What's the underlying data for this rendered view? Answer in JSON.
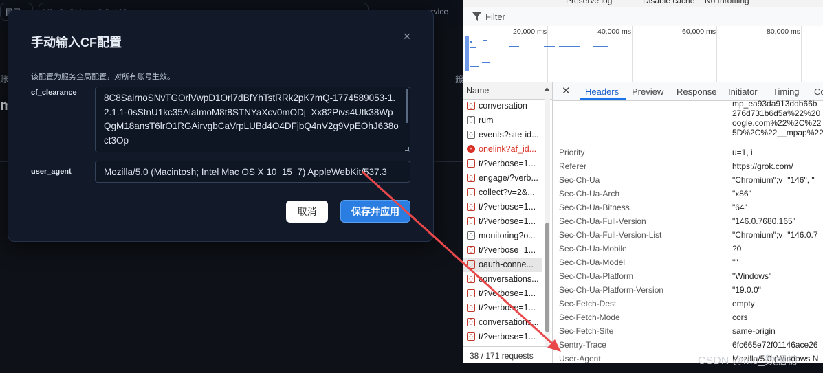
{
  "background": {
    "chips": [
      "目录",
      "V3. CLObjectnC.ll. 100",
      "service"
    ],
    "left_labels": [
      "账",
      "m"
    ],
    "right_label": "籤"
  },
  "modal": {
    "title": "手动输入CF配置",
    "close_glyph": "×",
    "description": "该配置为服务全局配置，对所有账号生效。",
    "cf_clearance_label": "cf_clearance",
    "cf_clearance_value": "8C8SairnoSNvTGOrlVwpD1Orl7dBfYhTstRRk2pK7mQ-1774589053-1.2.1.1-0sStnU1kc35AlaImoM8t8STNYaXcv0mODj_Xx82Pivs4Utk38WpQgM18ansT6lrO1RGAirvgbCaVrpLUBd4O4DFjbQ4nV2g9VpEOhJ638oct3Op",
    "user_agent_label": "user_agent",
    "user_agent_value": "Mozilla/5.0 (Macintosh; Intel Mac OS X 10_15_7) AppleWebKit/537.3",
    "cancel_label": "取消",
    "save_label": "保存并应用"
  },
  "devtools": {
    "top_items": [
      "Preserve log",
      "Disable cache",
      "No throttling"
    ],
    "filter_placeholder": "Filter",
    "ticks": [
      "20,000 ms",
      "40,000 ms",
      "60,000 ms",
      "80,000 ms"
    ],
    "name_header": "Name",
    "requests": [
      "conversation",
      "rum",
      "events?site-id...",
      "onelink?af_id...",
      "t/?verbose=1...",
      "engage/?verb...",
      "collect?v=2&...",
      "t/?verbose=1...",
      "t/?verbose=1...",
      "monitoring?o...",
      "t/?verbose=1...",
      "oauth-conne...",
      "conversations...",
      "t/?verbose=1...",
      "t/?verbose=1...",
      "conversations...",
      "t/?verbose=1..."
    ],
    "request_count": "38 / 171 requests",
    "tabs": [
      "Headers",
      "Preview",
      "Response",
      "Initiator",
      "Timing",
      "Co"
    ],
    "clipped_value_lines": [
      "mp_ea93da913ddb66b",
      "276d731b6d5a%22%20",
      "oogle.com%22%2C%22",
      "5D%2C%22__mpap%22"
    ],
    "headers": [
      {
        "key": "Priority",
        "value": "u=1, i"
      },
      {
        "key": "Referer",
        "value": "https://grok.com/"
      },
      {
        "key": "Sec-Ch-Ua",
        "value": "\"Chromium\";v=\"146\", \""
      },
      {
        "key": "Sec-Ch-Ua-Arch",
        "value": "\"x86\""
      },
      {
        "key": "Sec-Ch-Ua-Bitness",
        "value": "\"64\""
      },
      {
        "key": "Sec-Ch-Ua-Full-Version",
        "value": "\"146.0.7680.165\""
      },
      {
        "key": "Sec-Ch-Ua-Full-Version-List",
        "value": "\"Chromium\";v=\"146.0.7"
      },
      {
        "key": "Sec-Ch-Ua-Mobile",
        "value": "?0"
      },
      {
        "key": "Sec-Ch-Ua-Model",
        "value": "\"\""
      },
      {
        "key": "Sec-Ch-Ua-Platform",
        "value": "\"Windows\""
      },
      {
        "key": "Sec-Ch-Ua-Platform-Version",
        "value": "\"19.0.0\""
      },
      {
        "key": "Sec-Fetch-Dest",
        "value": "empty"
      },
      {
        "key": "Sec-Fetch-Mode",
        "value": "cors"
      },
      {
        "key": "Sec-Fetch-Site",
        "value": "same-origin"
      },
      {
        "key": "Sentry-Trace",
        "value": "6fc665e72f01146ace26"
      },
      {
        "key": "User-Agent",
        "value": "Mozilla/5.0 (Windows N"
      }
    ]
  },
  "watermark": "CSDN @m0_数据初",
  "colors": {
    "accent": "#2a7de1",
    "arrow": "#e8484a",
    "modal_bg": "#121a2a"
  }
}
